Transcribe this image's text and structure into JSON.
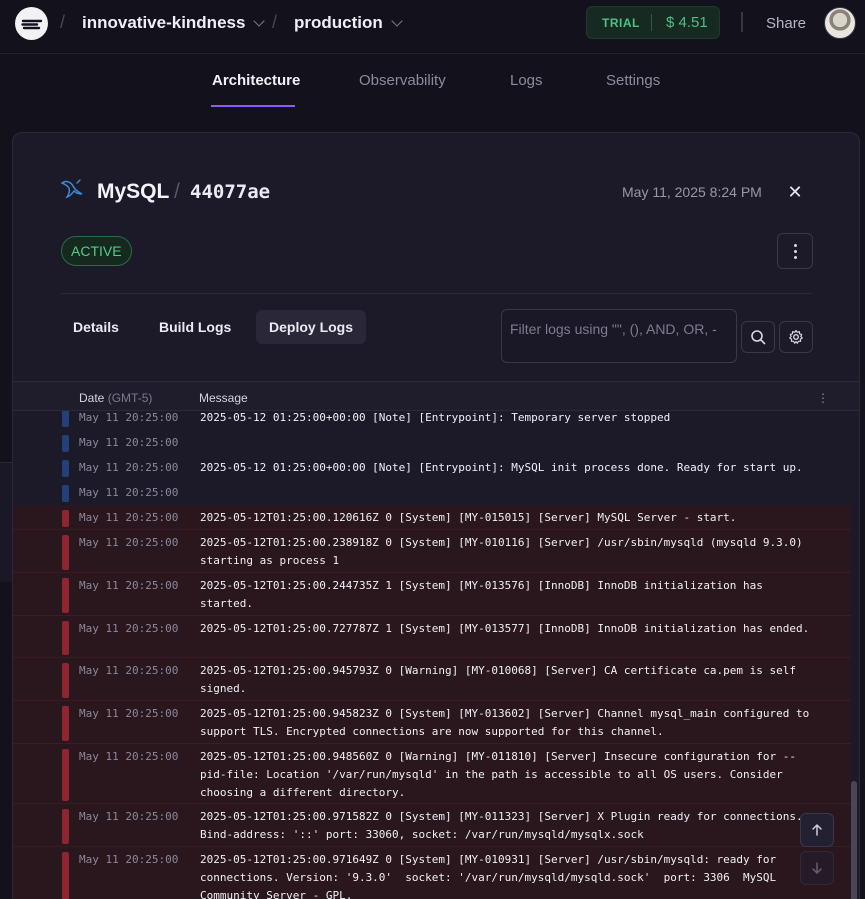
{
  "topbar": {
    "project": "innovative-kindness",
    "environment": "production",
    "trial_label": "TRIAL",
    "trial_amount": "$ 4.51",
    "share": "Share"
  },
  "tabs": [
    {
      "label": "Architecture",
      "active": true
    },
    {
      "label": "Observability",
      "active": false
    },
    {
      "label": "Logs",
      "active": false
    },
    {
      "label": "Settings",
      "active": false
    }
  ],
  "service": {
    "name": "MySQL",
    "id": "44077ae",
    "date": "May 11, 2025 8:24 PM",
    "status": "ACTIVE"
  },
  "subtabs": [
    {
      "label": "Details",
      "active": false
    },
    {
      "label": "Build Logs",
      "active": false
    },
    {
      "label": "Deploy Logs",
      "active": true
    }
  ],
  "filter": {
    "placeholder": "Filter logs using \"\", (), AND, OR, -"
  },
  "log_header": {
    "date": "Date",
    "tz": "(GMT-5)",
    "message": "Message"
  },
  "logs": [
    {
      "level": "info",
      "ts": "May 11 20:25:00",
      "msg": "2025-05-12 01:25:00+00:00 [Note] [Entrypoint]: Temporary server stopped"
    },
    {
      "level": "info",
      "ts": "May 11 20:25:00",
      "msg": ""
    },
    {
      "level": "info",
      "ts": "May 11 20:25:00",
      "msg": "2025-05-12 01:25:00+00:00 [Note] [Entrypoint]: MySQL init process done. Ready for start up."
    },
    {
      "level": "info",
      "ts": "May 11 20:25:00",
      "msg": ""
    },
    {
      "level": "err",
      "ts": "May 11 20:25:00",
      "msg": "2025-05-12T01:25:00.120616Z 0 [System] [MY-015015] [Server] MySQL Server - start."
    },
    {
      "level": "err",
      "ts": "May 11 20:25:00",
      "msg": "2025-05-12T01:25:00.238918Z 0 [System] [MY-010116] [Server] /usr/sbin/mysqld (mysqld 9.3.0) starting as process 1"
    },
    {
      "level": "err",
      "ts": "May 11 20:25:00",
      "msg": "2025-05-12T01:25:00.244735Z 1 [System] [MY-013576] [InnoDB] InnoDB initialization has started."
    },
    {
      "level": "err",
      "ts": "May 11 20:25:00",
      "msg": "2025-05-12T01:25:00.727787Z 1 [System] [MY-013577] [InnoDB] InnoDB initialization has ended."
    },
    {
      "level": "err",
      "ts": "May 11 20:25:00",
      "msg": "2025-05-12T01:25:00.945793Z 0 [Warning] [MY-010068] [Server] CA certificate ca.pem is self signed."
    },
    {
      "level": "err",
      "ts": "May 11 20:25:00",
      "msg": "2025-05-12T01:25:00.945823Z 0 [System] [MY-013602] [Server] Channel mysql_main configured to support TLS. Encrypted connections are now supported for this channel."
    },
    {
      "level": "err",
      "ts": "May 11 20:25:00",
      "msg": "2025-05-12T01:25:00.948560Z 0 [Warning] [MY-011810] [Server] Insecure configuration for --pid-file: Location '/var/run/mysqld' in the path is accessible to all OS users. Consider choosing a different directory."
    },
    {
      "level": "err",
      "ts": "May 11 20:25:00",
      "msg": "2025-05-12T01:25:00.971582Z 0 [System] [MY-011323] [Server] X Plugin ready for connections. Bind-address: '::' port: 33060, socket: /var/run/mysqld/mysqlx.sock"
    },
    {
      "level": "err",
      "ts": "May 11 20:25:00",
      "msg": "2025-05-12T01:25:00.971649Z 0 [System] [MY-010931] [Server] /usr/sbin/mysqld: ready for connections. Version: '9.3.0'  socket: '/var/run/mysqld/mysqld.sock'  port: 3306  MySQL Community Server - GPL."
    }
  ],
  "colors": {
    "accent": "#8b5cf6",
    "active_green": "#56c98d",
    "info_bar": "#24407a",
    "error_bar": "#8e2530"
  },
  "icons": {
    "logo": "railway-logo-icon",
    "service": "mysql-dolphin-icon",
    "close": "close-icon",
    "more": "more-vertical-icon",
    "search": "search-icon",
    "settings": "gear-icon",
    "scroll_up": "arrow-up-icon",
    "scroll_down": "arrow-down-icon"
  }
}
